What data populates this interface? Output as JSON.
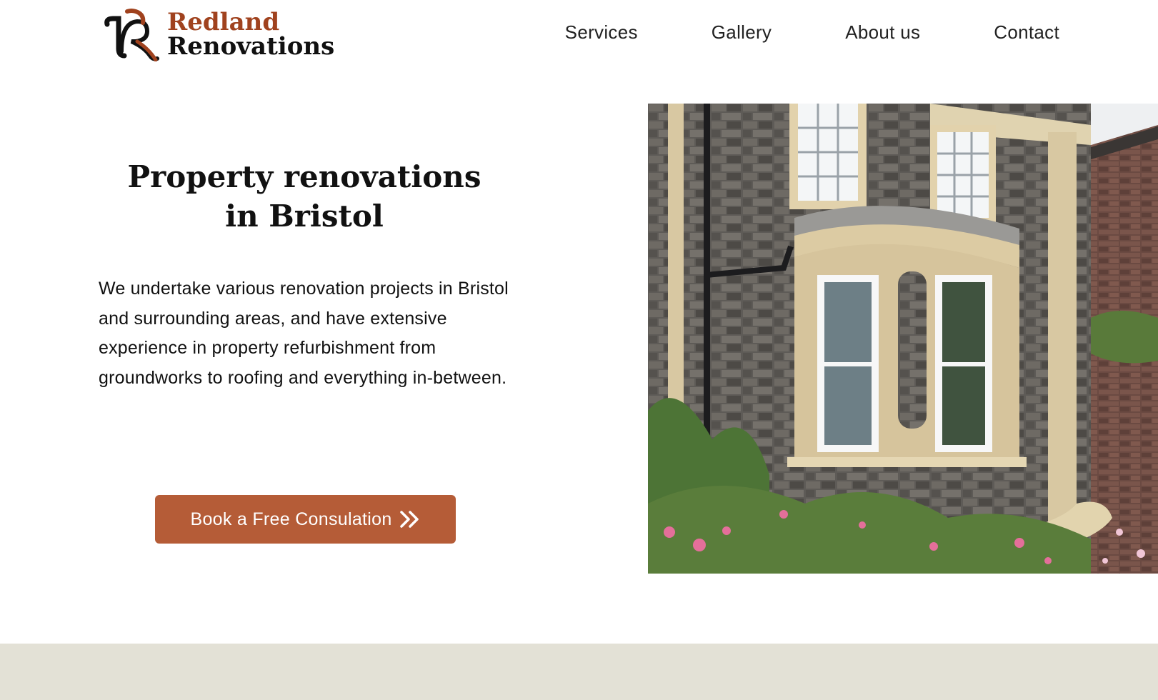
{
  "brand": {
    "name_line1": "Redland",
    "name_line2": "Renovations",
    "accent_color": "#a0421e"
  },
  "nav": {
    "items": [
      {
        "label": "Services"
      },
      {
        "label": "Gallery"
      },
      {
        "label": "About us"
      },
      {
        "label": "Contact"
      }
    ]
  },
  "hero": {
    "title_line1": "Property renovations",
    "title_line2": "in Bristol",
    "description": "We undertake various renovation projects in Bristol and surrounding areas, and have extensive experience in property refurbishment from groundworks to roofing and everything in-between.",
    "cta_label": "Book a Free Consulation",
    "cta_icon": "double-chevron-right-icon",
    "cta_color": "#b55c37"
  },
  "image": {
    "subject": "stone house with bay window and garden"
  },
  "footer": {
    "band_color": "#e3e1d6"
  }
}
